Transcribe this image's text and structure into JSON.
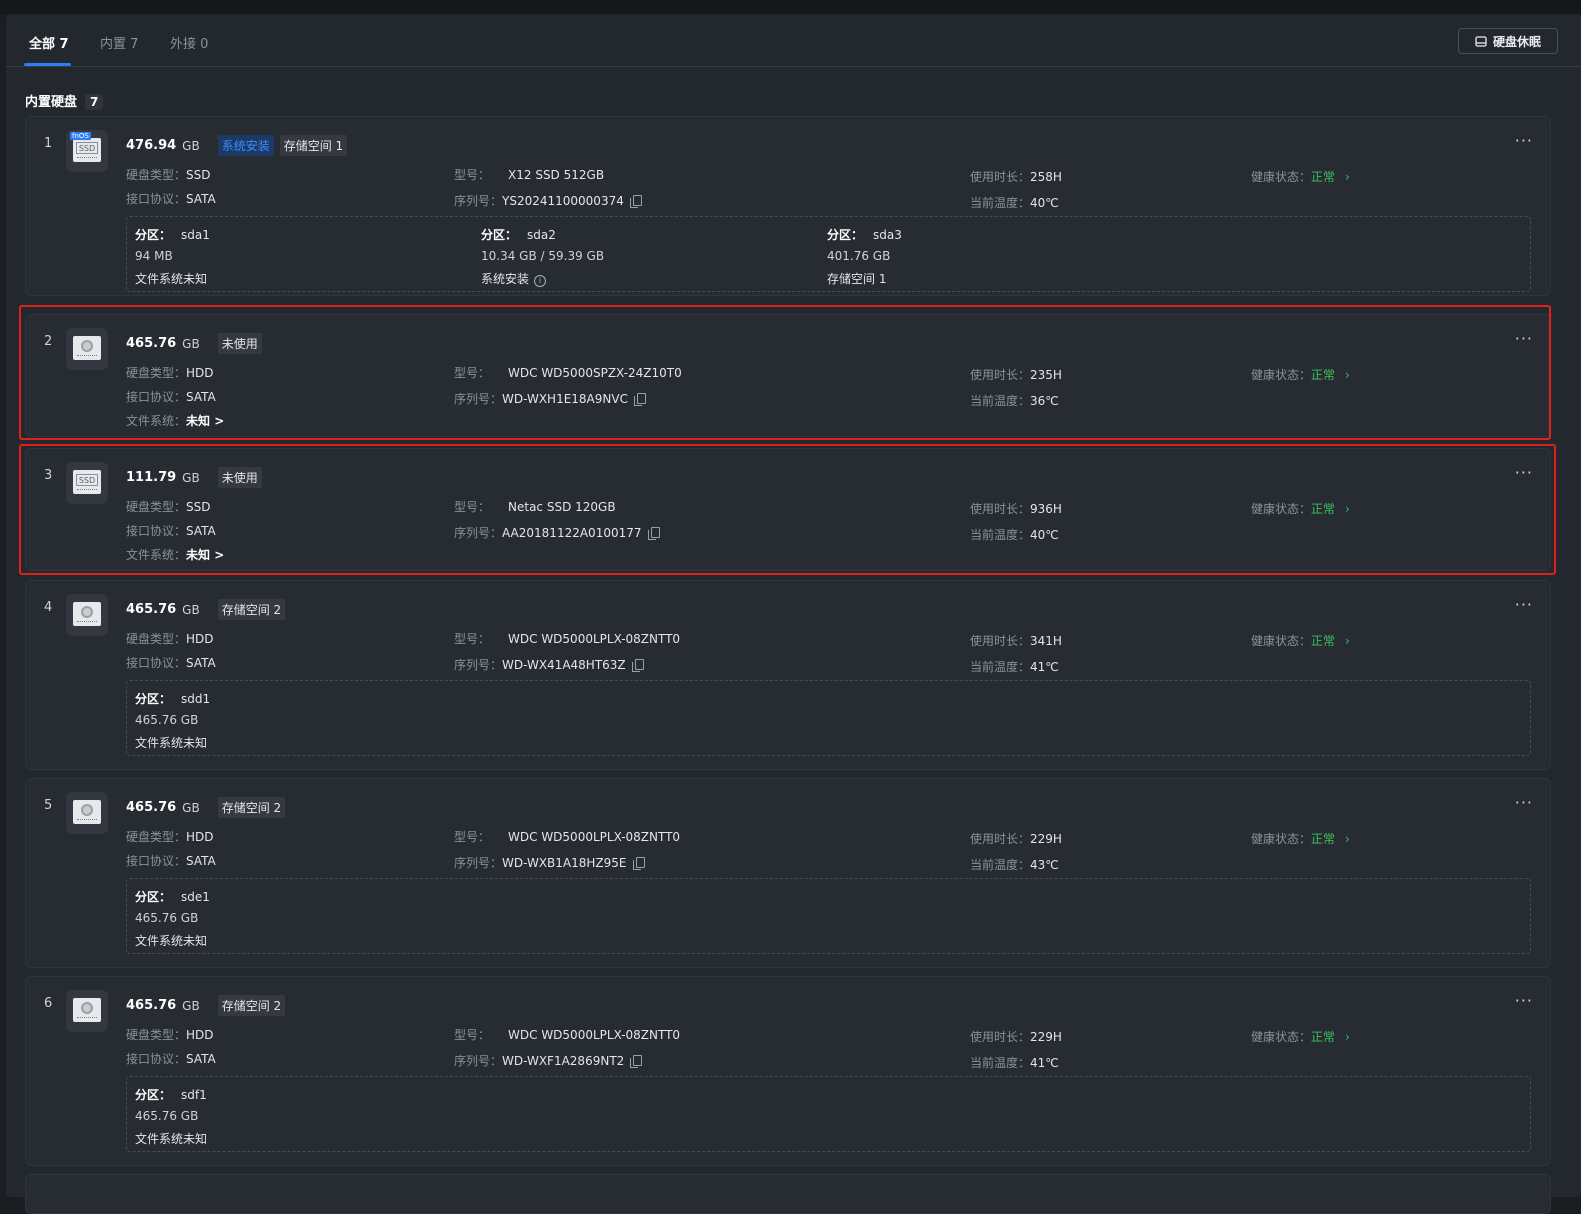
{
  "tabs": {
    "all": "全部 7",
    "internal": "内置 7",
    "external": "外接 0"
  },
  "sleep_button": "硬盘休眠",
  "section": {
    "title": "内置硬盘",
    "count": "7"
  },
  "labels": {
    "type": "硬盘类型：",
    "iface": "接口协议：",
    "model": "型号：",
    "serial": "序列号：",
    "hours": "使用时长：",
    "temp": "当前温度：",
    "health": "健康状态：",
    "fs": "文件系统：",
    "partition": "分区："
  },
  "disks": [
    {
      "index": "1",
      "cap": "476.94",
      "unit": "GB",
      "icon": "ssd-fnos",
      "tags": [
        "系统安装",
        "存储空间 1"
      ],
      "type": "SSD",
      "iface": "SATA",
      "model": "X12 SSD 512GB",
      "serial": "YS20241100000374",
      "hours": "258H",
      "temp": "40℃",
      "health": "正常",
      "partitions": [
        {
          "name": "sda1",
          "size": "94 MB",
          "fs": "文件系统未知"
        },
        {
          "name": "sda2",
          "size": "10.34 GB / 59.39 GB",
          "fs": "系统安装"
        },
        {
          "name": "sda3",
          "size": "401.76 GB",
          "fs": "存储空间 1"
        }
      ]
    },
    {
      "index": "2",
      "cap": "465.76",
      "unit": "GB",
      "icon": "hdd",
      "tags": [
        "未使用"
      ],
      "type": "HDD",
      "iface": "SATA",
      "model": "WDC WD5000SPZX-24Z10T0",
      "serial": "WD-WXH1E18A9NVC",
      "hours": "235H",
      "temp": "36℃",
      "health": "正常",
      "fs": "未知 >"
    },
    {
      "index": "3",
      "cap": "111.79",
      "unit": "GB",
      "icon": "ssd",
      "tags": [
        "未使用"
      ],
      "type": "SSD",
      "iface": "SATA",
      "model": "Netac SSD 120GB",
      "serial": "AA20181122A0100177",
      "hours": "936H",
      "temp": "40℃",
      "health": "正常",
      "fs": "未知 >"
    },
    {
      "index": "4",
      "cap": "465.76",
      "unit": "GB",
      "icon": "hdd",
      "tags": [
        "存储空间 2"
      ],
      "type": "HDD",
      "iface": "SATA",
      "model": "WDC WD5000LPLX-08ZNTT0",
      "serial": "WD-WX41A48HT63Z",
      "hours": "341H",
      "temp": "41℃",
      "health": "正常",
      "partitions": [
        {
          "name": "sdd1",
          "size": "465.76 GB",
          "fs": "文件系统未知"
        }
      ]
    },
    {
      "index": "5",
      "cap": "465.76",
      "unit": "GB",
      "icon": "hdd",
      "tags": [
        "存储空间 2"
      ],
      "type": "HDD",
      "iface": "SATA",
      "model": "WDC WD5000LPLX-08ZNTT0",
      "serial": "WD-WXB1A18HZ95E",
      "hours": "229H",
      "temp": "43℃",
      "health": "正常",
      "partitions": [
        {
          "name": "sde1",
          "size": "465.76 GB",
          "fs": "文件系统未知"
        }
      ]
    },
    {
      "index": "6",
      "cap": "465.76",
      "unit": "GB",
      "icon": "hdd",
      "tags": [
        "存储空间 2"
      ],
      "type": "HDD",
      "iface": "SATA",
      "model": "WDC WD5000LPLX-08ZNTT0",
      "serial": "WD-WXF1A2869NT2",
      "hours": "229H",
      "temp": "41℃",
      "health": "正常",
      "partitions": [
        {
          "name": "sdf1",
          "size": "465.76 GB",
          "fs": "文件系统未知"
        }
      ]
    }
  ],
  "colors": {
    "accent": "#2f7cf6",
    "health_ok": "#3fbf5f",
    "highlight": "#e0211b"
  }
}
